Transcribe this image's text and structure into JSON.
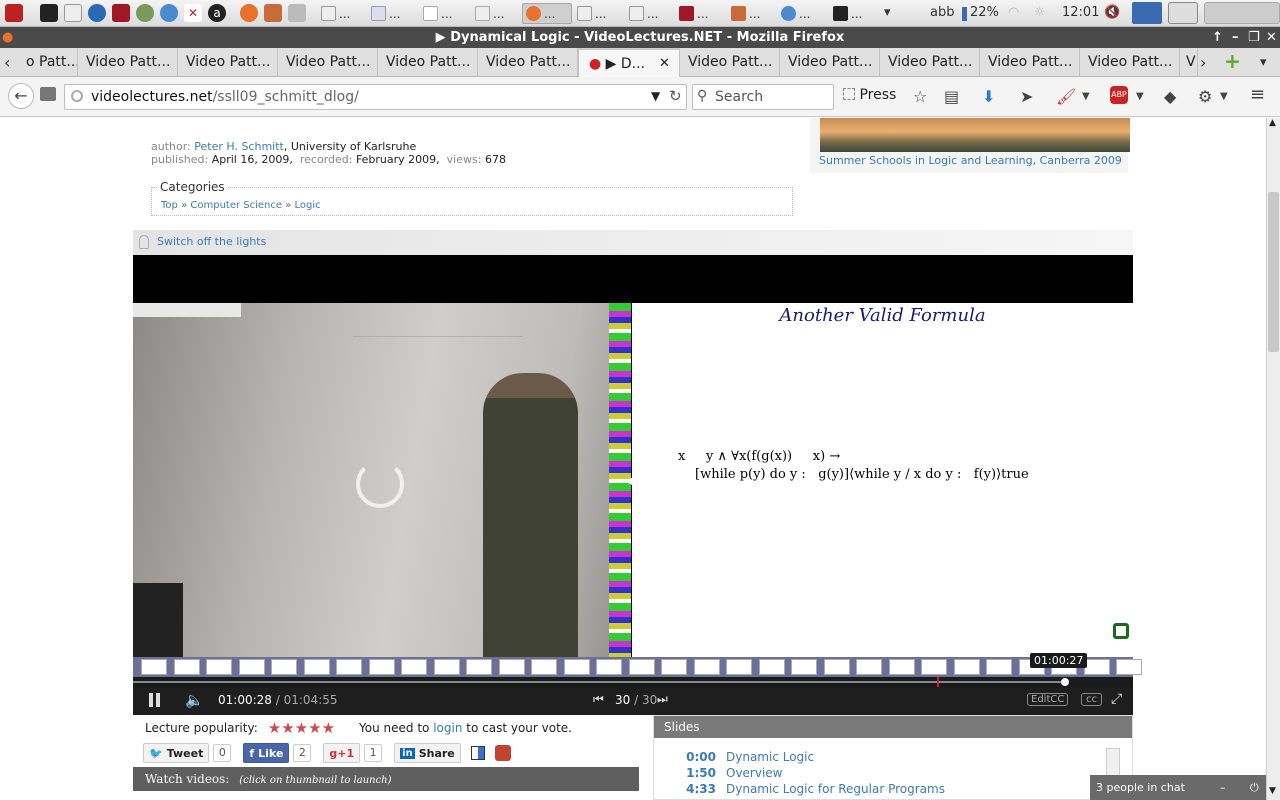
{
  "taskbar": {
    "tasks": [
      {
        "label": "...",
        "active": true
      },
      {
        "label": "..."
      },
      {
        "label": "..."
      },
      {
        "label": "..."
      },
      {
        "label": "..."
      },
      {
        "label": "..."
      },
      {
        "label": "..."
      },
      {
        "label": "..."
      },
      {
        "label": "..."
      },
      {
        "label": "..."
      }
    ],
    "keyboard_layout": "abb",
    "battery": "22%",
    "clock": "12:01"
  },
  "window": {
    "title": "▶ Dynamical Logic - VideoLectures.NET - Mozilla Firefox"
  },
  "tabs": [
    {
      "label": "o Patt..."
    },
    {
      "label": "Video Patt..."
    },
    {
      "label": "Video Patt..."
    },
    {
      "label": "Video Patt..."
    },
    {
      "label": "Video Patt..."
    },
    {
      "label": "Video Patt..."
    },
    {
      "label": "▶ D...",
      "active": true
    },
    {
      "label": "Video Patt..."
    },
    {
      "label": "Video Patt..."
    },
    {
      "label": "Video Patt..."
    },
    {
      "label": "Video Patt..."
    },
    {
      "label": "Video Patt..."
    },
    {
      "label": "V"
    }
  ],
  "nav": {
    "url_domain": "videolectures.net",
    "url_path": "/ssll09_schmitt_dlog/",
    "search_placeholder": "Search",
    "press_label": "Press"
  },
  "lecture": {
    "author_label": "author:",
    "author_name": "Peter H. Schmitt",
    "author_affiliation": ", University of Karlsruhe",
    "published_label": "published:",
    "published": "April 16, 2009,",
    "recorded_label": "recorded:",
    "recorded": "February 2009,",
    "views_label": "views:",
    "views": "678",
    "categories_title": "Categories",
    "categories": [
      "Top",
      "Computer Science",
      "Logic"
    ],
    "breadcrumb_sep": "»",
    "event_link": "Summer Schools in Logic and Learning, Canberra 2009",
    "lights_label": "Switch off the lights"
  },
  "player": {
    "slide_title": "Another Valid Formula",
    "slide_line1": "x     y ∧ ∀x(f(g(x))     x) →",
    "slide_line2": "[while p(y) do y :   g(y)]⟨while y / x do y :   f(y)⟩true",
    "current_time": "01:00:28",
    "total_time": "01:04:55",
    "time_sep": "/",
    "hover_time": "01:00:27",
    "slide_index": "30",
    "slide_total": "30",
    "slide_sep": "/",
    "editcc_label": "EditCC",
    "cc_label": "cc",
    "progress_fraction": 0.932
  },
  "social": {
    "popularity_label": "Lecture popularity:",
    "vote_prefix": "You need to",
    "vote_link": "login",
    "vote_suffix": "to cast your vote.",
    "tweet_label": "Tweet",
    "tweet_count": "0",
    "like_label": "Like",
    "like_count": "2",
    "gplus_label": "g+1",
    "gplus_count": "1",
    "share_label": "Share"
  },
  "watch": {
    "label": "Watch videos:",
    "hint": "(click on thumbnail to launch)"
  },
  "slides": {
    "title": "Slides",
    "items": [
      {
        "time": "0:00",
        "title": "Dynamic Logic"
      },
      {
        "time": "1:50",
        "title": "Overview"
      },
      {
        "time": "4:33",
        "title": "Dynamic Logic for Regular Programs"
      }
    ]
  },
  "chat": {
    "label": "3 people in chat"
  }
}
